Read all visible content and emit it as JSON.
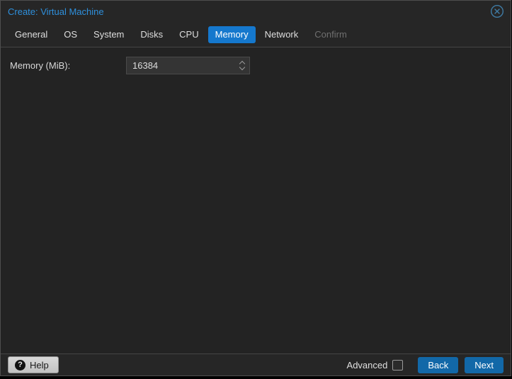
{
  "dialog": {
    "title": "Create: Virtual Machine"
  },
  "tabs": [
    {
      "label": "General",
      "state": "normal"
    },
    {
      "label": "OS",
      "state": "normal"
    },
    {
      "label": "System",
      "state": "normal"
    },
    {
      "label": "Disks",
      "state": "normal"
    },
    {
      "label": "CPU",
      "state": "normal"
    },
    {
      "label": "Memory",
      "state": "active"
    },
    {
      "label": "Network",
      "state": "normal"
    },
    {
      "label": "Confirm",
      "state": "disabled"
    }
  ],
  "form": {
    "memory_label": "Memory (MiB):",
    "memory_value": "16384"
  },
  "footer": {
    "help_label": "Help",
    "help_icon_glyph": "?",
    "advanced_label": "Advanced",
    "advanced_checked": false,
    "back_label": "Back",
    "next_label": "Next"
  },
  "colors": {
    "active_tab_blue": "#1578cd",
    "button_blue": "#1268a8",
    "title_blue": "#2e90dd",
    "close_icon_blue": "#3f7ca6",
    "dialog_bg": "#242424",
    "field_bg": "#343434"
  }
}
